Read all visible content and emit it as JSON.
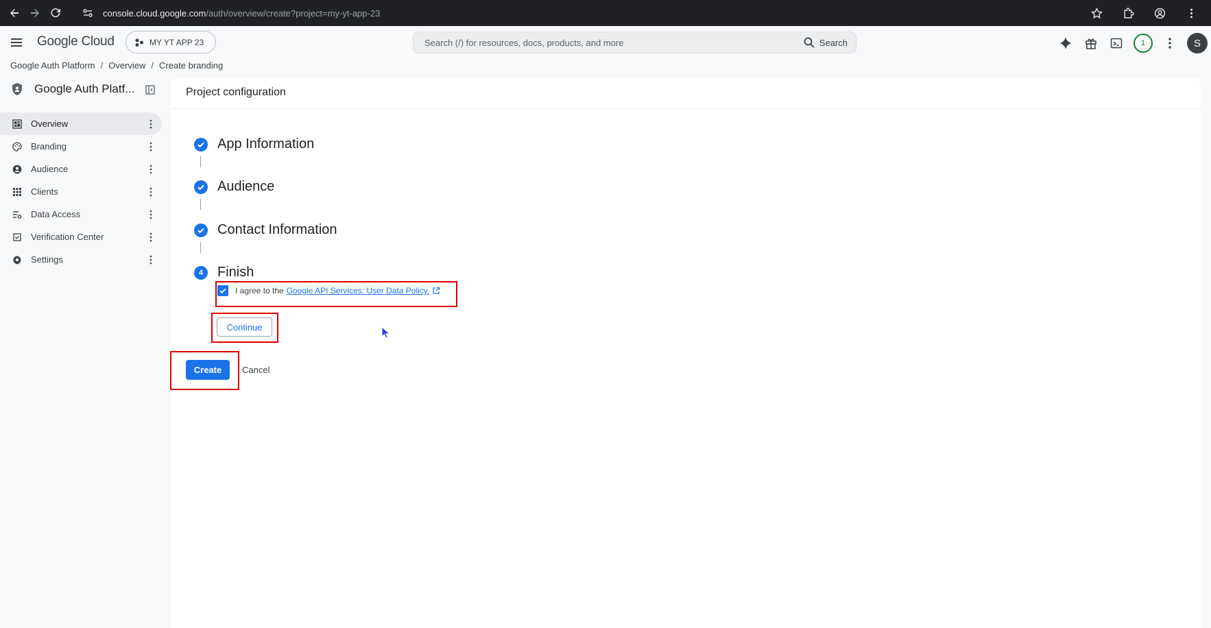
{
  "browser": {
    "url_domain": "console.cloud.google.com",
    "url_path": "/auth/overview/create?project=my-yt-app-23"
  },
  "header": {
    "brand": "Google Cloud",
    "project_name": "MY YT APP 23",
    "search_placeholder": "Search (/) for resources, docs, products, and more",
    "search_button": "Search",
    "notification_count": "1",
    "avatar_initial": "S"
  },
  "breadcrumb": [
    "Google Auth Platform",
    "Overview",
    "Create branding"
  ],
  "sidebar": {
    "title": "Google Auth Platf...",
    "items": [
      {
        "label": "Overview",
        "icon": "dashboard-icon",
        "active": true
      },
      {
        "label": "Branding",
        "icon": "palette-icon",
        "active": false
      },
      {
        "label": "Audience",
        "icon": "person-icon",
        "active": false
      },
      {
        "label": "Clients",
        "icon": "grid-icon",
        "active": false
      },
      {
        "label": "Data Access",
        "icon": "data-access-icon",
        "active": false
      },
      {
        "label": "Verification Center",
        "icon": "verification-icon",
        "active": false
      },
      {
        "label": "Settings",
        "icon": "gear-icon",
        "active": false
      }
    ]
  },
  "main": {
    "title": "Project configuration",
    "steps": [
      {
        "label": "App Information",
        "status": "complete"
      },
      {
        "label": "Audience",
        "status": "complete"
      },
      {
        "label": "Contact Information",
        "status": "complete"
      },
      {
        "label": "Finish",
        "status": "current",
        "number": "4"
      }
    ],
    "agree_prefix": "I agree to the",
    "agree_link": "Google API Services: User Data Policy.",
    "agree_checked": true,
    "continue_label": "Continue",
    "create_label": "Create",
    "cancel_label": "Cancel"
  },
  "colors": {
    "accent": "#1a73e8",
    "highlight": "#dd0000"
  }
}
